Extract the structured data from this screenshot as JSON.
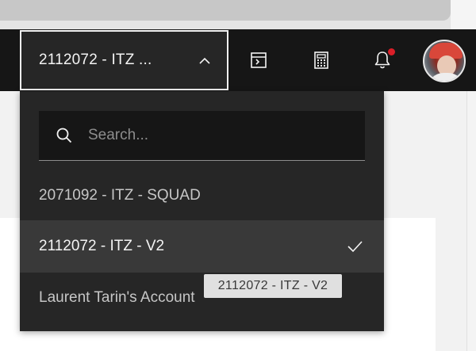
{
  "header": {
    "account_switcher": {
      "label": "2112072 - ITZ ...",
      "expanded": true
    },
    "icons": [
      "terminal-icon",
      "calculator-icon",
      "notification-icon",
      "user-avatar"
    ],
    "notification_dot_color": "#da1e28"
  },
  "dropdown": {
    "search": {
      "placeholder": "Search...",
      "value": ""
    },
    "items": [
      {
        "label": "2071092 - ITZ - SQUAD",
        "selected": false
      },
      {
        "label": "2112072 - ITZ - V2",
        "selected": true
      },
      {
        "label": "Laurent Tarin's Account",
        "selected": false
      }
    ]
  },
  "tooltip": {
    "text": "2112072 - ITZ - V2"
  },
  "colors": {
    "header_bg": "#161616",
    "dropdown_bg": "#262626",
    "selected_bg": "#393939",
    "text_primary": "#f4f4f4",
    "text_secondary": "#c6c6c6"
  }
}
